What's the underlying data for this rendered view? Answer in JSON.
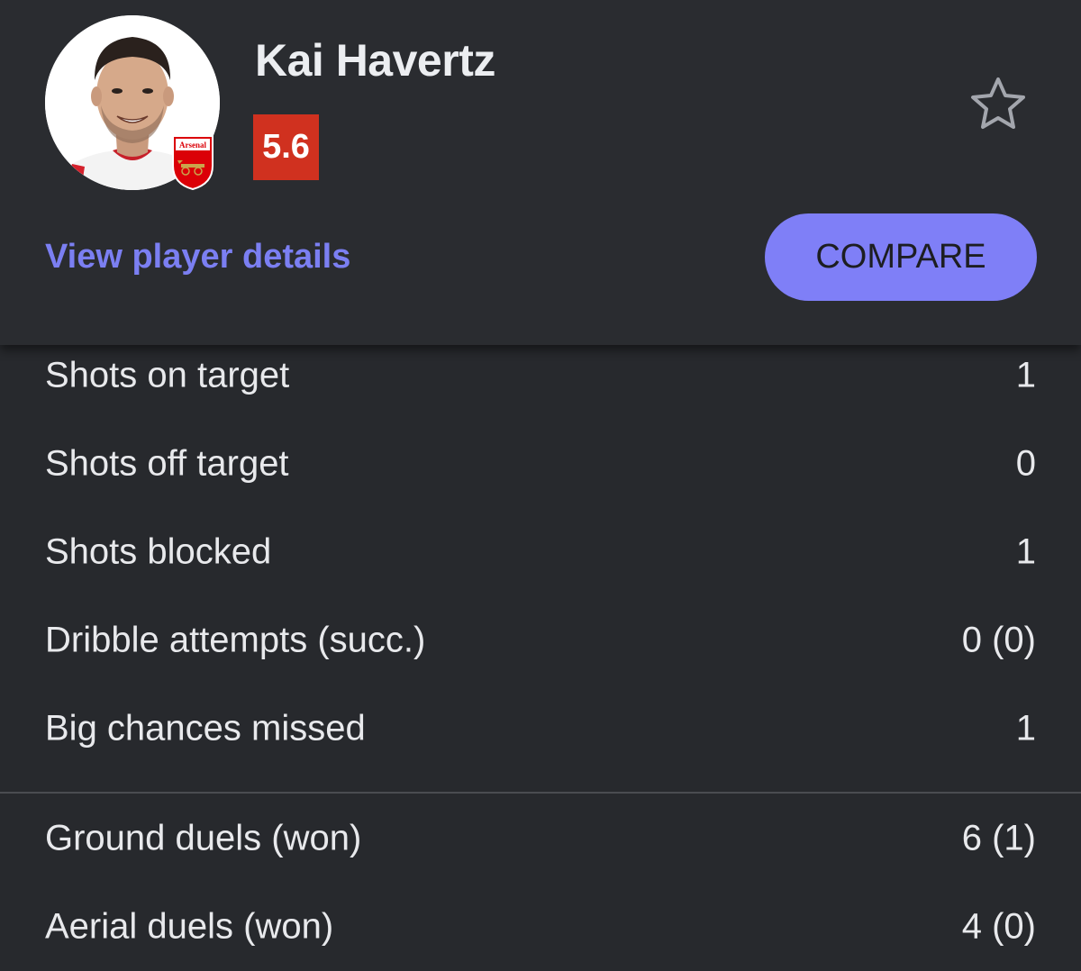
{
  "player": {
    "name": "Kai Havertz",
    "rating": "5.6",
    "club": "Arsenal",
    "rating_color": "#d0311f"
  },
  "actions": {
    "details_link": "View player details",
    "compare_label": "COMPARE",
    "accent": "#7f7ff7",
    "favorite_icon": "star-outline-icon"
  },
  "stats_group_1": [
    {
      "label": "Shots on target",
      "value": "1"
    },
    {
      "label": "Shots off target",
      "value": "0"
    },
    {
      "label": "Shots blocked",
      "value": "1"
    },
    {
      "label": "Dribble attempts (succ.)",
      "value": "0 (0)"
    },
    {
      "label": "Big chances missed",
      "value": "1"
    }
  ],
  "stats_group_2": [
    {
      "label": "Ground duels (won)",
      "value": "6 (1)"
    },
    {
      "label": "Aerial duels (won)",
      "value": "4 (0)"
    }
  ]
}
